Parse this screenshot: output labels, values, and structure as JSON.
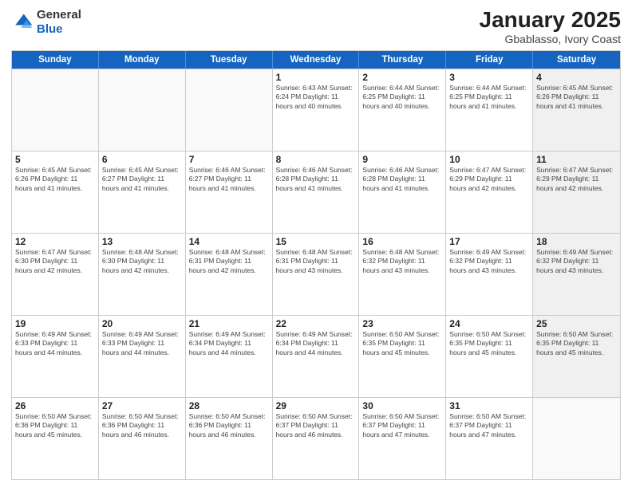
{
  "logo": {
    "general": "General",
    "blue": "Blue"
  },
  "title": {
    "month": "January 2025",
    "location": "Gbablasso, Ivory Coast"
  },
  "header": {
    "days": [
      "Sunday",
      "Monday",
      "Tuesday",
      "Wednesday",
      "Thursday",
      "Friday",
      "Saturday"
    ]
  },
  "weeks": [
    [
      {
        "day": "",
        "info": "",
        "empty": true
      },
      {
        "day": "",
        "info": "",
        "empty": true
      },
      {
        "day": "",
        "info": "",
        "empty": true
      },
      {
        "day": "1",
        "info": "Sunrise: 6:43 AM\nSunset: 6:24 PM\nDaylight: 11 hours\nand 40 minutes.",
        "empty": false
      },
      {
        "day": "2",
        "info": "Sunrise: 6:44 AM\nSunset: 6:25 PM\nDaylight: 11 hours\nand 40 minutes.",
        "empty": false
      },
      {
        "day": "3",
        "info": "Sunrise: 6:44 AM\nSunset: 6:25 PM\nDaylight: 11 hours\nand 41 minutes.",
        "empty": false
      },
      {
        "day": "4",
        "info": "Sunrise: 6:45 AM\nSunset: 6:26 PM\nDaylight: 11 hours\nand 41 minutes.",
        "empty": false,
        "shaded": true
      }
    ],
    [
      {
        "day": "5",
        "info": "Sunrise: 6:45 AM\nSunset: 6:26 PM\nDaylight: 11 hours\nand 41 minutes.",
        "empty": false
      },
      {
        "day": "6",
        "info": "Sunrise: 6:45 AM\nSunset: 6:27 PM\nDaylight: 11 hours\nand 41 minutes.",
        "empty": false
      },
      {
        "day": "7",
        "info": "Sunrise: 6:46 AM\nSunset: 6:27 PM\nDaylight: 11 hours\nand 41 minutes.",
        "empty": false
      },
      {
        "day": "8",
        "info": "Sunrise: 6:46 AM\nSunset: 6:28 PM\nDaylight: 11 hours\nand 41 minutes.",
        "empty": false
      },
      {
        "day": "9",
        "info": "Sunrise: 6:46 AM\nSunset: 6:28 PM\nDaylight: 11 hours\nand 41 minutes.",
        "empty": false
      },
      {
        "day": "10",
        "info": "Sunrise: 6:47 AM\nSunset: 6:29 PM\nDaylight: 11 hours\nand 42 minutes.",
        "empty": false
      },
      {
        "day": "11",
        "info": "Sunrise: 6:47 AM\nSunset: 6:29 PM\nDaylight: 11 hours\nand 42 minutes.",
        "empty": false,
        "shaded": true
      }
    ],
    [
      {
        "day": "12",
        "info": "Sunrise: 6:47 AM\nSunset: 6:30 PM\nDaylight: 11 hours\nand 42 minutes.",
        "empty": false
      },
      {
        "day": "13",
        "info": "Sunrise: 6:48 AM\nSunset: 6:30 PM\nDaylight: 11 hours\nand 42 minutes.",
        "empty": false
      },
      {
        "day": "14",
        "info": "Sunrise: 6:48 AM\nSunset: 6:31 PM\nDaylight: 11 hours\nand 42 minutes.",
        "empty": false
      },
      {
        "day": "15",
        "info": "Sunrise: 6:48 AM\nSunset: 6:31 PM\nDaylight: 11 hours\nand 43 minutes.",
        "empty": false
      },
      {
        "day": "16",
        "info": "Sunrise: 6:48 AM\nSunset: 6:32 PM\nDaylight: 11 hours\nand 43 minutes.",
        "empty": false
      },
      {
        "day": "17",
        "info": "Sunrise: 6:49 AM\nSunset: 6:32 PM\nDaylight: 11 hours\nand 43 minutes.",
        "empty": false
      },
      {
        "day": "18",
        "info": "Sunrise: 6:49 AM\nSunset: 6:32 PM\nDaylight: 11 hours\nand 43 minutes.",
        "empty": false,
        "shaded": true
      }
    ],
    [
      {
        "day": "19",
        "info": "Sunrise: 6:49 AM\nSunset: 6:33 PM\nDaylight: 11 hours\nand 44 minutes.",
        "empty": false
      },
      {
        "day": "20",
        "info": "Sunrise: 6:49 AM\nSunset: 6:33 PM\nDaylight: 11 hours\nand 44 minutes.",
        "empty": false
      },
      {
        "day": "21",
        "info": "Sunrise: 6:49 AM\nSunset: 6:34 PM\nDaylight: 11 hours\nand 44 minutes.",
        "empty": false
      },
      {
        "day": "22",
        "info": "Sunrise: 6:49 AM\nSunset: 6:34 PM\nDaylight: 11 hours\nand 44 minutes.",
        "empty": false
      },
      {
        "day": "23",
        "info": "Sunrise: 6:50 AM\nSunset: 6:35 PM\nDaylight: 11 hours\nand 45 minutes.",
        "empty": false
      },
      {
        "day": "24",
        "info": "Sunrise: 6:50 AM\nSunset: 6:35 PM\nDaylight: 11 hours\nand 45 minutes.",
        "empty": false
      },
      {
        "day": "25",
        "info": "Sunrise: 6:50 AM\nSunset: 6:35 PM\nDaylight: 11 hours\nand 45 minutes.",
        "empty": false,
        "shaded": true
      }
    ],
    [
      {
        "day": "26",
        "info": "Sunrise: 6:50 AM\nSunset: 6:36 PM\nDaylight: 11 hours\nand 45 minutes.",
        "empty": false
      },
      {
        "day": "27",
        "info": "Sunrise: 6:50 AM\nSunset: 6:36 PM\nDaylight: 11 hours\nand 46 minutes.",
        "empty": false
      },
      {
        "day": "28",
        "info": "Sunrise: 6:50 AM\nSunset: 6:36 PM\nDaylight: 11 hours\nand 46 minutes.",
        "empty": false
      },
      {
        "day": "29",
        "info": "Sunrise: 6:50 AM\nSunset: 6:37 PM\nDaylight: 11 hours\nand 46 minutes.",
        "empty": false
      },
      {
        "day": "30",
        "info": "Sunrise: 6:50 AM\nSunset: 6:37 PM\nDaylight: 11 hours\nand 47 minutes.",
        "empty": false
      },
      {
        "day": "31",
        "info": "Sunrise: 6:50 AM\nSunset: 6:37 PM\nDaylight: 11 hours\nand 47 minutes.",
        "empty": false
      },
      {
        "day": "",
        "info": "",
        "empty": true,
        "shaded": true
      }
    ]
  ]
}
